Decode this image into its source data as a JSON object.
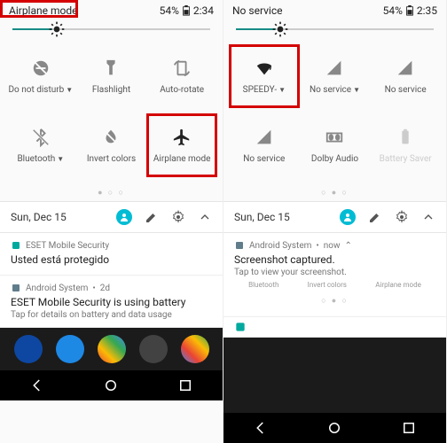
{
  "left": {
    "status": {
      "title": "Airplane mode",
      "battery": "54%",
      "time": "2:34"
    },
    "tiles": [
      {
        "label": "Do not disturb",
        "caret": true
      },
      {
        "label": "Flashlight",
        "caret": false
      },
      {
        "label": "Auto-rotate",
        "caret": false
      },
      {
        "label": "Bluetooth",
        "caret": true
      },
      {
        "label": "Invert colors",
        "caret": false
      },
      {
        "label": "Airplane mode",
        "caret": false
      }
    ],
    "date": "Sun, Dec 15",
    "notif1": {
      "app": "ESET Mobile Security",
      "title": "Usted está protegido"
    },
    "notif2": {
      "app": "Android System",
      "age": "2d",
      "title": "ESET Mobile Security is using battery",
      "body": "Tap for details on battery and data usage"
    }
  },
  "right": {
    "status": {
      "title": "No service",
      "battery": "54%",
      "time": "2:35"
    },
    "tiles": [
      {
        "label": "SPEEDY-",
        "caret": true
      },
      {
        "label": "No service",
        "caret": true
      },
      {
        "label": "No service",
        "caret": false
      },
      {
        "label": "No service",
        "caret": false
      },
      {
        "label": "Dolby Audio",
        "caret": false
      },
      {
        "label": "Battery Saver",
        "caret": false
      }
    ],
    "date": "Sun, Dec 15",
    "notif1": {
      "app": "Android System",
      "age": "now",
      "title": "Screenshot captured.",
      "body": "Tap to view your screenshot."
    },
    "mini": [
      "Bluetooth",
      "Invert colors",
      "Airplane mode"
    ]
  }
}
